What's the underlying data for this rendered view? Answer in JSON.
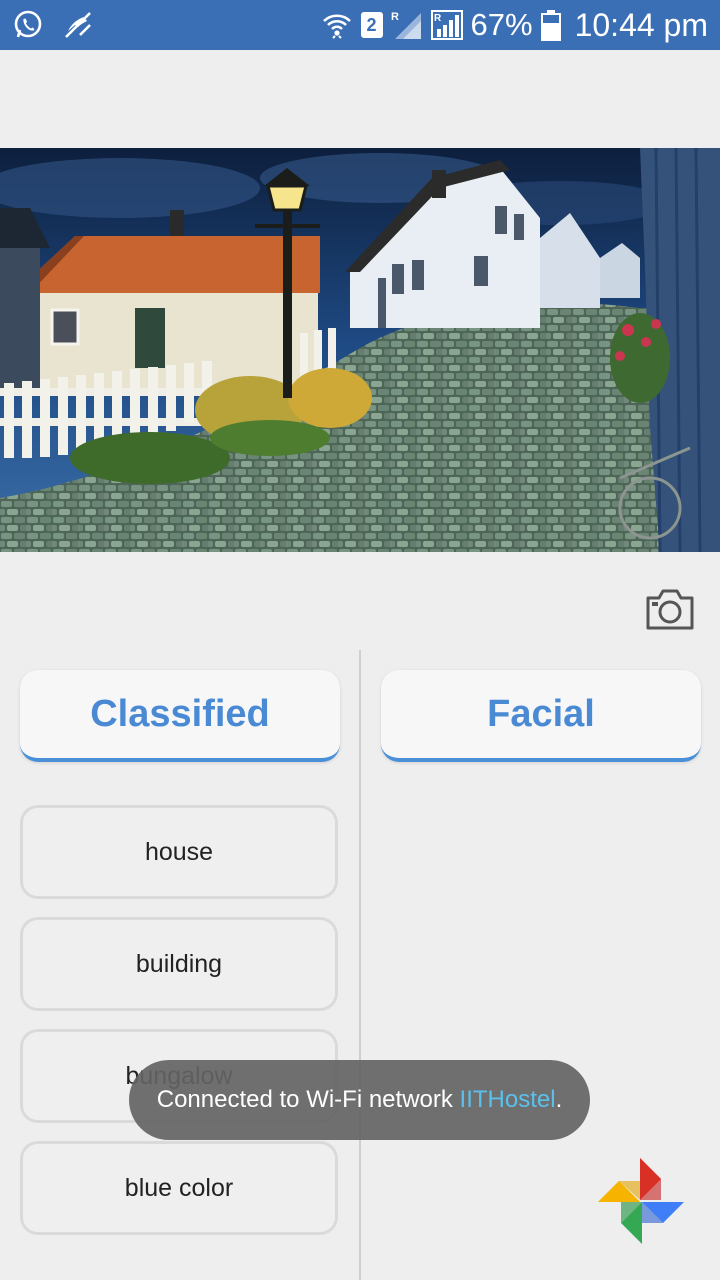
{
  "status_bar": {
    "battery": "67%",
    "time": "10:44 pm",
    "sim": "2",
    "roaming_1": "R",
    "roaming_2": "R",
    "icons": [
      "whatsapp-icon",
      "missed-call-icon",
      "wifi-icon",
      "sim-icon",
      "signal-icon",
      "signal-icon",
      "battery-icon"
    ]
  },
  "photo": {
    "description_icon": "village-photo"
  },
  "tabs": {
    "classified": "Classified",
    "facial": "Facial"
  },
  "results": [
    "house",
    "building",
    "bungalow",
    "blue color"
  ],
  "toast": {
    "prefix": "Connected to Wi-Fi network ",
    "network": "IITHostel",
    "suffix": "."
  },
  "colors": {
    "status_bar": "#3b6fb5",
    "accent": "#4a8ad4",
    "toast_link": "#5bc0eb"
  }
}
